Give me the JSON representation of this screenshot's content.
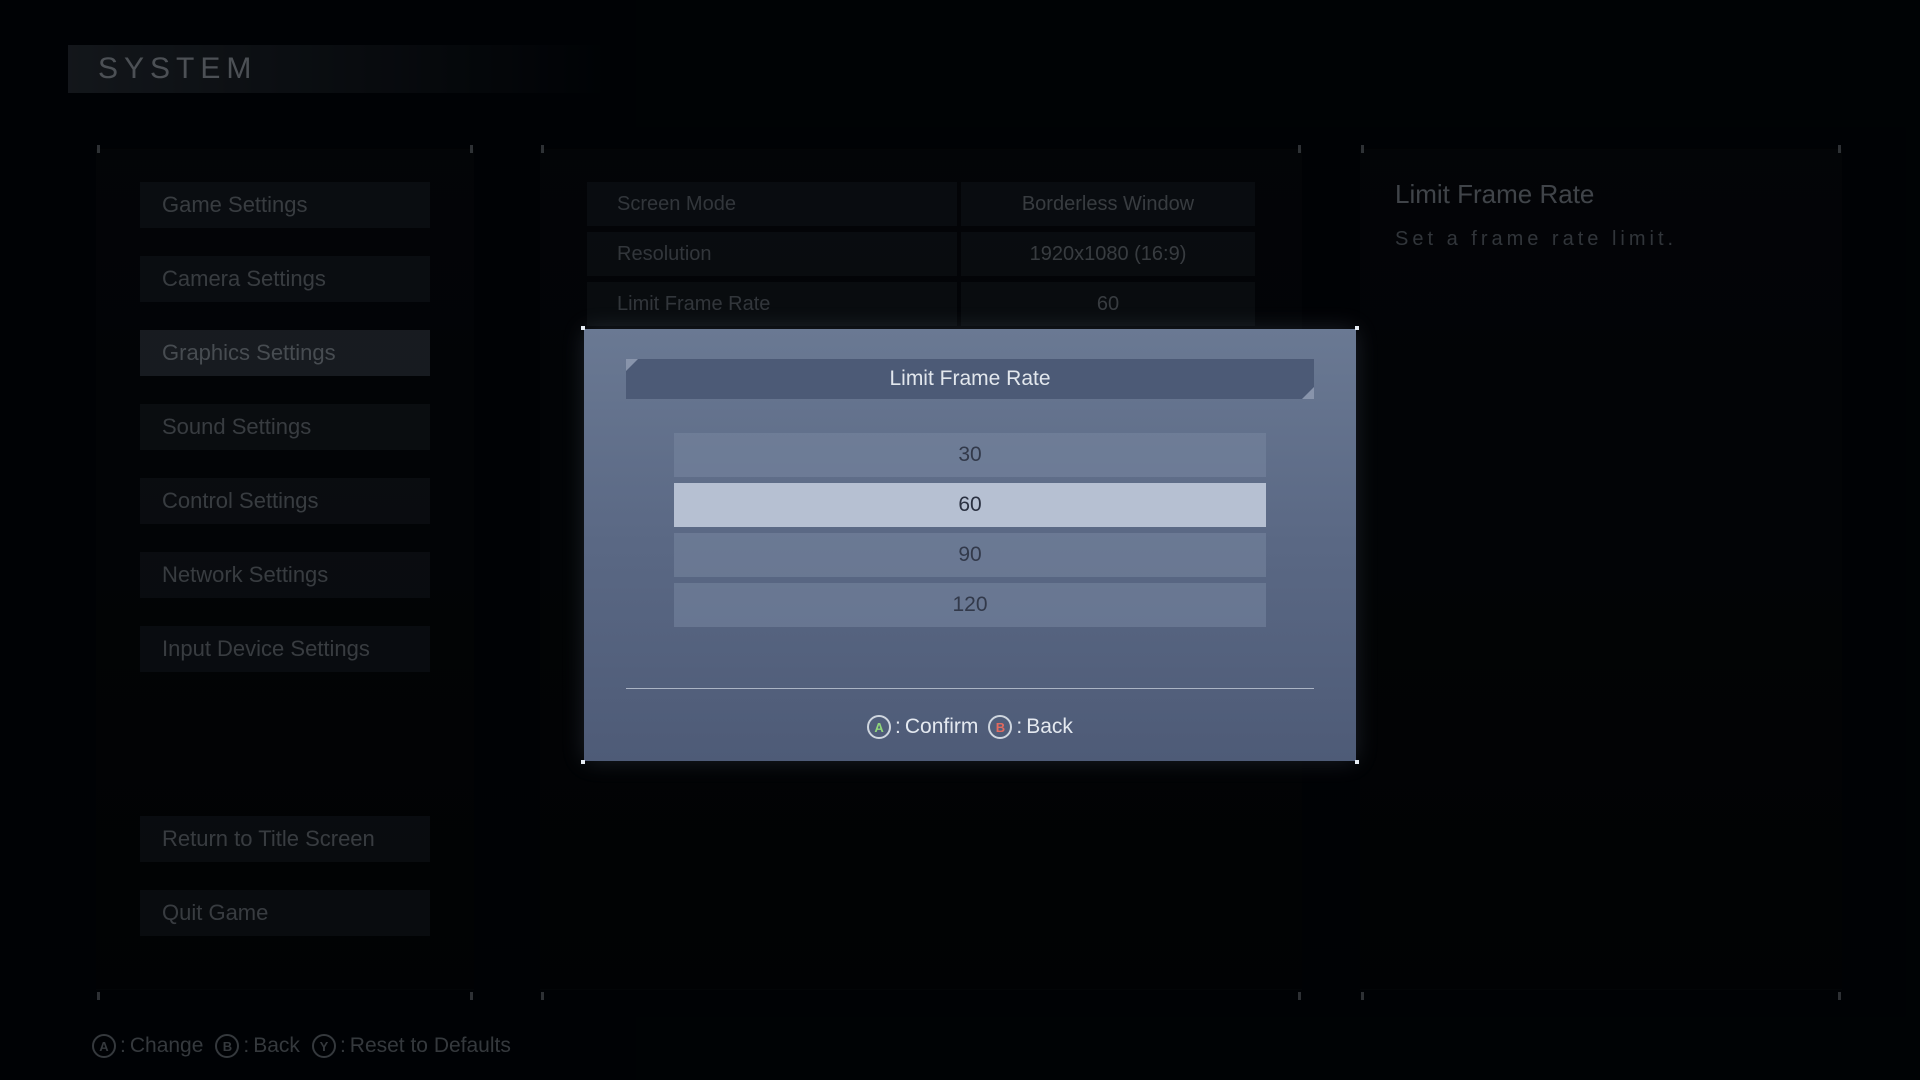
{
  "header": {
    "title": "SYSTEM"
  },
  "sidebar": {
    "items": [
      {
        "label": "Game Settings",
        "active": false
      },
      {
        "label": "Camera Settings",
        "active": false
      },
      {
        "label": "Graphics Settings",
        "active": true
      },
      {
        "label": "Sound Settings",
        "active": false
      },
      {
        "label": "Control Settings",
        "active": false
      },
      {
        "label": "Network Settings",
        "active": false
      },
      {
        "label": "Input Device Settings",
        "active": false
      }
    ],
    "bottom": [
      {
        "label": "Return to Title Screen"
      },
      {
        "label": "Quit Game"
      }
    ]
  },
  "settings": {
    "rows": [
      {
        "label": "Screen Mode",
        "value": "Borderless Window"
      },
      {
        "label": "Resolution",
        "value": "1920x1080 (16:9)"
      },
      {
        "label": "Limit Frame Rate",
        "value": "60"
      }
    ]
  },
  "info": {
    "title": "Limit Frame Rate",
    "desc": "Set a frame rate limit."
  },
  "footer": {
    "hints": [
      {
        "key": "A",
        "label": "Change"
      },
      {
        "key": "B",
        "label": "Back"
      },
      {
        "key": "Y",
        "label": "Reset to Defaults"
      }
    ]
  },
  "modal": {
    "title": "Limit Frame Rate",
    "options": [
      {
        "label": "30",
        "selected": false
      },
      {
        "label": "60",
        "selected": true
      },
      {
        "label": "90",
        "selected": false
      },
      {
        "label": "120",
        "selected": false
      }
    ],
    "hints": [
      {
        "key": "A",
        "label": "Confirm"
      },
      {
        "key": "B",
        "label": "Back"
      }
    ]
  }
}
